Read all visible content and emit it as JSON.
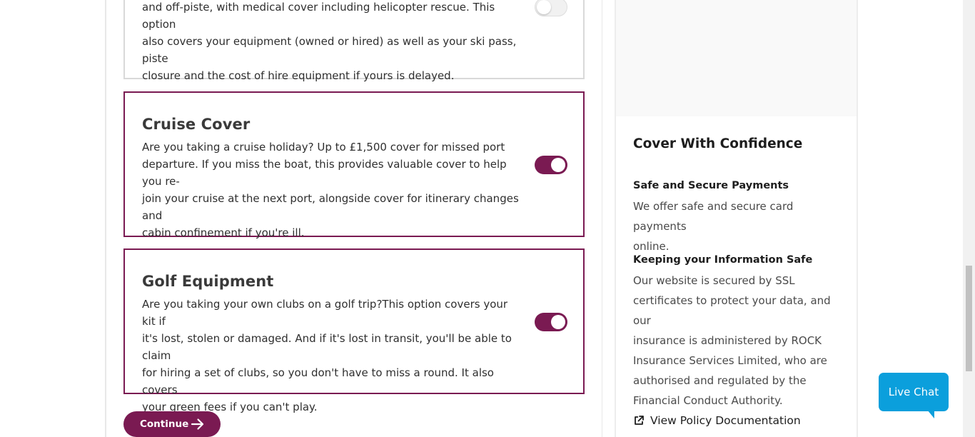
{
  "options": [
    {
      "title": "",
      "lines": [
        "and off-piste, with medical cover including helicopter rescue. This option",
        "also covers your equipment (owned or hired) as well as your ski pass, piste",
        "closure and the cost of hire equipment if yours is delayed."
      ],
      "enabled": false
    },
    {
      "title": "Cruise Cover",
      "lines": [
        "Are you taking a cruise holiday? Up to £1,500 cover for missed port",
        "departure. If you miss the boat, this provides valuable cover to help you re-",
        "join your cruise at the next port, alongside cover for itinerary changes and",
        "cabin confinement if you're ill."
      ],
      "enabled": true
    },
    {
      "title": "Golf Equipment",
      "lines": [
        "Are you taking your own clubs on a golf trip?This option covers your kit if",
        "it's lost, stolen or damaged. And if it's lost in transit, you'll be able to claim",
        "for hiring a set of clubs, so you don't have to miss a round. It also covers",
        "your green fees if you can't play."
      ],
      "enabled": true
    }
  ],
  "continue_label": "Continue",
  "sidebar": {
    "title": "Cover With Confidence",
    "payments_heading": "Safe and Secure Payments",
    "payments_lines": [
      "We offer safe and secure card payments",
      "online."
    ],
    "info_heading": "Keeping your Information Safe",
    "info_lines": [
      "Our website is secured by SSL",
      "certificates to protect your data, and our",
      "insurance is administered by ROCK",
      "Insurance Services Limited, who are",
      "authorised and regulated by the",
      "Financial Conduct Authority."
    ],
    "doc_link": "View Policy Documentation"
  },
  "live_chat_label": "Live Chat",
  "colors": {
    "brand": "#7a1a52",
    "chat": "#0b9fdc"
  },
  "icons": {
    "continue": "arrow-right-icon",
    "doc_link": "external-link-icon"
  }
}
